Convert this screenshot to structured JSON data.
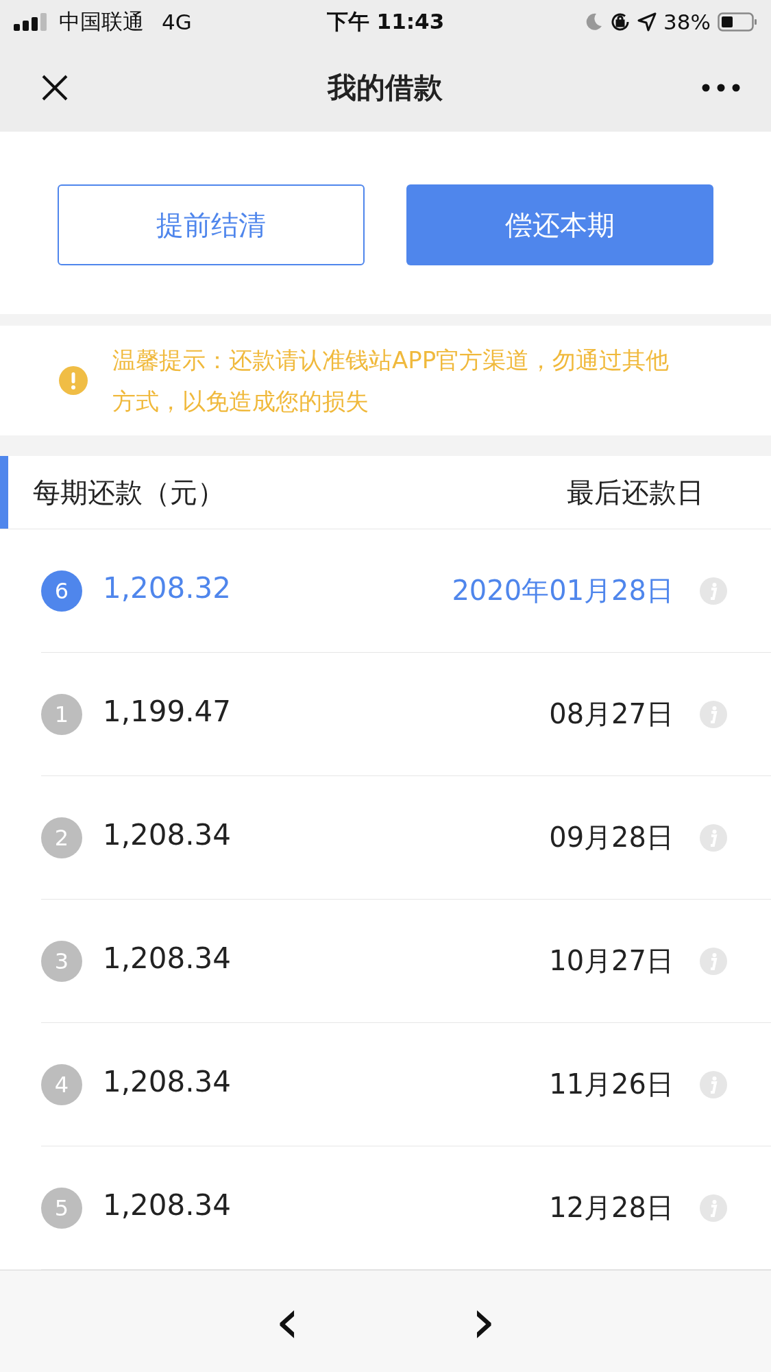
{
  "status_bar": {
    "carrier": "中国联通",
    "network": "4G",
    "time": "下午 11:43",
    "battery": "38%"
  },
  "nav": {
    "title": "我的借款"
  },
  "summary": {
    "buttons": [
      {
        "label": "提前结清",
        "kind": "outline"
      },
      {
        "label": "偿还本期",
        "kind": "primary"
      }
    ]
  },
  "notice": {
    "text": "温馨提示：还款请认准钱站APP官方渠道，勿通过其他方式，以免造成您的损失"
  },
  "schedule": {
    "columns": [
      "每期还款（元）",
      "最后还款日"
    ],
    "rows": [
      {
        "index": "6",
        "amount": "1,208.32",
        "date": "2020年01月28日",
        "selected": true
      },
      {
        "index": "1",
        "amount": "1,199.47",
        "date": "08月27日",
        "selected": false
      },
      {
        "index": "2",
        "amount": "1,208.34",
        "date": "09月28日",
        "selected": false
      },
      {
        "index": "3",
        "amount": "1,208.34",
        "date": "10月27日",
        "selected": false
      },
      {
        "index": "4",
        "amount": "1,208.34",
        "date": "11月26日",
        "selected": false
      },
      {
        "index": "5",
        "amount": "1,208.34",
        "date": "12月28日",
        "selected": false
      }
    ]
  },
  "toolbar": {
    "back": "‹",
    "forward": "›"
  }
}
